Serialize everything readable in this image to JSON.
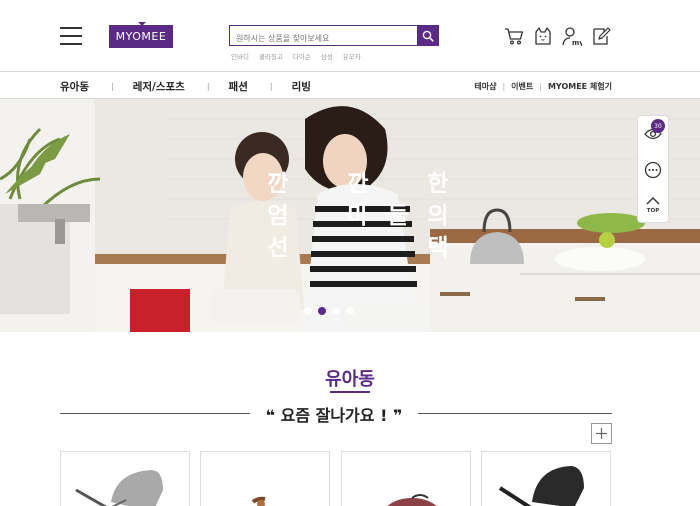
{
  "header": {
    "logo_text": "MYOMEE",
    "search": {
      "placeholder": "원하시는 상품을 찾아보세요",
      "value": ""
    },
    "keywords": [
      "인바디",
      "쿨라징고",
      "다이슨",
      "삼성",
      "유모차"
    ],
    "icons": [
      "cart-icon",
      "cat-face-icon",
      "my-page-icon",
      "write-icon"
    ],
    "my_label": "my"
  },
  "gnb": {
    "left": [
      "유아동",
      "레저/스포츠",
      "패션",
      "리빙"
    ],
    "right": [
      "테마샵",
      "이벤트",
      "MYOMEE 체험기"
    ]
  },
  "hero": {
    "copy_rows": [
      [
        "깐",
        "",
        "깐",
        "",
        "한"
      ],
      [
        "엄",
        "",
        "마",
        "들",
        "의"
      ],
      [
        "선",
        "",
        "",
        "",
        "택"
      ]
    ],
    "slide_count": 4,
    "active_slide": 2
  },
  "quick": {
    "badge_count": "30",
    "top_label": "TOP"
  },
  "section": {
    "title": "유아동",
    "subtitle_open": "❝",
    "subtitle_text": "요즘 잘나가요 !",
    "subtitle_close": "❞"
  },
  "colors": {
    "brand": "#5b2a86"
  }
}
